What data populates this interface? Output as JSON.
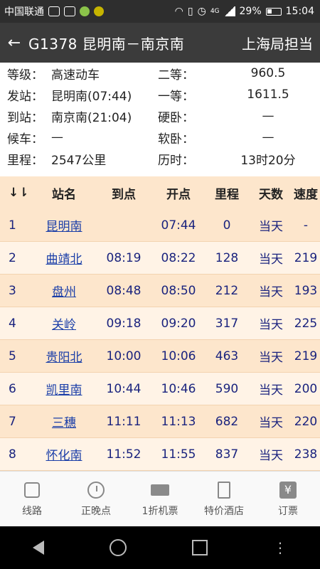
{
  "status_bar": {
    "carrier": "中国联通",
    "battery": "29%",
    "time": "15:04",
    "signal_label": "4G"
  },
  "app_bar": {
    "title": "G1378 昆明南－南京南",
    "bureau": "上海局担当",
    "back_icon": "arrow-left-icon"
  },
  "info": {
    "rows": [
      {
        "label1": "等级：",
        "val1": "高速动车",
        "label2": "二等：",
        "val2": "960.5"
      },
      {
        "label1": "发站：",
        "val1": "昆明南(07:44)",
        "label2": "一等：",
        "val2": "1611.5"
      },
      {
        "label1": "到站：",
        "val1": "南京南(21:04)",
        "label2": "硬卧：",
        "val2": "—"
      },
      {
        "label1": "候车：",
        "val1": "—",
        "label2": "软卧：",
        "val2": "—"
      },
      {
        "label1": "里程：",
        "val1": "2547公里",
        "label2": "历时：",
        "val2": "13时20分"
      }
    ]
  },
  "table": {
    "headers": {
      "no": "↓⇂",
      "name": "站名",
      "arrive": "到点",
      "depart": "开点",
      "distance": "里程",
      "days": "天数",
      "speed": "速度"
    },
    "rows": [
      {
        "no": "1",
        "name": "昆明南",
        "arrive": "",
        "depart": "07:44",
        "distance": "0",
        "days": "当天",
        "speed": "-"
      },
      {
        "no": "2",
        "name": "曲靖北",
        "arrive": "08:19",
        "depart": "08:22",
        "distance": "128",
        "days": "当天",
        "speed": "219"
      },
      {
        "no": "3",
        "name": "盘州",
        "arrive": "08:48",
        "depart": "08:50",
        "distance": "212",
        "days": "当天",
        "speed": "193"
      },
      {
        "no": "4",
        "name": "关岭",
        "arrive": "09:18",
        "depart": "09:20",
        "distance": "317",
        "days": "当天",
        "speed": "225"
      },
      {
        "no": "5",
        "name": "贵阳北",
        "arrive": "10:00",
        "depart": "10:06",
        "distance": "463",
        "days": "当天",
        "speed": "219"
      },
      {
        "no": "6",
        "name": "凯里南",
        "arrive": "10:44",
        "depart": "10:46",
        "distance": "590",
        "days": "当天",
        "speed": "200"
      },
      {
        "no": "7",
        "name": "三穗",
        "arrive": "11:11",
        "depart": "11:13",
        "distance": "682",
        "days": "当天",
        "speed": "220"
      },
      {
        "no": "8",
        "name": "怀化南",
        "arrive": "11:52",
        "depart": "11:55",
        "distance": "837",
        "days": "当天",
        "speed": "238"
      }
    ]
  },
  "tabs": [
    {
      "label": "线路",
      "icon": "map-icon"
    },
    {
      "label": "正晚点",
      "icon": "clock-icon"
    },
    {
      "label": "1折机票",
      "icon": "ticket-icon"
    },
    {
      "label": "特价酒店",
      "icon": "hotel-icon"
    },
    {
      "label": "订票",
      "icon": "yen-icon"
    }
  ],
  "colors": {
    "header_bg": "#3b3b3b",
    "row_odd": "#fde6cc",
    "row_even": "#fff3e6",
    "link": "#1a3ea8"
  }
}
